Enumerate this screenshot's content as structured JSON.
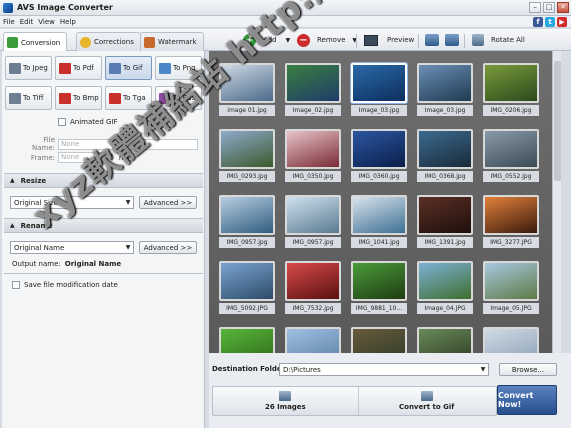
{
  "window": {
    "title": "AVS Image Converter"
  },
  "menu": [
    "File",
    "Edit",
    "View",
    "Help"
  ],
  "social": [
    "f",
    "t",
    "▶"
  ],
  "tabs": [
    {
      "label": "Conversion",
      "color": "#3a9c3a"
    },
    {
      "label": "Corrections",
      "color": "#e7b52a"
    },
    {
      "label": "Watermark",
      "color": "#c7692e"
    }
  ],
  "toolbar": {
    "add": "Add",
    "remove": "Remove",
    "preview": "Preview",
    "rotate": "Rotate All"
  },
  "formats": [
    {
      "label": "To Jpeg",
      "color": "#6f7f93"
    },
    {
      "label": "To Pdf",
      "color": "#c9302c"
    },
    {
      "label": "To Gif",
      "color": "#5a7cb4",
      "active": true
    },
    {
      "label": "To Png",
      "color": "#4c88c8"
    },
    {
      "label": "To Tiff",
      "color": "#6f7f93"
    },
    {
      "label": "To Bmp",
      "color": "#c9302c"
    },
    {
      "label": "To Tga",
      "color": "#c9302c"
    },
    {
      "label": "To Ras",
      "color": "#8a4c9c"
    }
  ],
  "options": {
    "animated_gif": "Animated GIF",
    "file_name_label": "File Name:",
    "file_name_value": "None",
    "frame_label": "Frame:",
    "frame_value": "None",
    "frame_unit": "ms"
  },
  "resize": {
    "header": "Resize",
    "select": "Original Size",
    "advanced": "Advanced >>"
  },
  "rename": {
    "header": "Rename",
    "select": "Original Name",
    "advanced": "Advanced >>",
    "output_label": "Output name:",
    "output_value": "Original Name"
  },
  "save_mod_date": "Save file modification date",
  "images": [
    {
      "name": "image 01.jpg",
      "c1": "#cfd9e4",
      "c2": "#4b6a8a"
    },
    {
      "name": "Image_02.jpg",
      "c1": "#3a7f3f",
      "c2": "#1e3c6a"
    },
    {
      "name": "Image_03.jpg",
      "c1": "#2a6aa8",
      "c2": "#0d2e5e"
    },
    {
      "name": "Image_03.jpg",
      "c1": "#6b8fb5",
      "c2": "#1f3a52"
    },
    {
      "name": "IMG_0206.jpg",
      "c1": "#7a9a3a",
      "c2": "#2b4a1e"
    },
    {
      "name": "IMG_0293.jpg",
      "c1": "#8fa9cc",
      "c2": "#3b5a2c"
    },
    {
      "name": "IMG_0350.jpg",
      "c1": "#e7c5c8",
      "c2": "#7a2b36"
    },
    {
      "name": "IMG_0360.jpg",
      "c1": "#2b56a1",
      "c2": "#0b1f4a"
    },
    {
      "name": "IMG_0368.jpg",
      "c1": "#3b6a8f",
      "c2": "#1a2b3a"
    },
    {
      "name": "IMG_0552.jpg",
      "c1": "#8a9aa8",
      "c2": "#3a4a55"
    },
    {
      "name": "IMG_0957.jpg",
      "c1": "#b8cde0",
      "c2": "#2f5d80"
    },
    {
      "name": "IMG_0957.jpg",
      "c1": "#cfe1ee",
      "c2": "#5a7a90"
    },
    {
      "name": "IMG_1041.jpg",
      "c1": "#d9e3ea",
      "c2": "#3d6f95"
    },
    {
      "name": "IMG_1391.jpg",
      "c1": "#5a2f25",
      "c2": "#1e0f0c"
    },
    {
      "name": "IMG_3277.JPG",
      "c1": "#e2813a",
      "c2": "#3a1a0d"
    },
    {
      "name": "IMG_5092.JPG",
      "c1": "#7aa3cf",
      "c2": "#2c4c6a"
    },
    {
      "name": "IMG_7532.jpg",
      "c1": "#d84a4a",
      "c2": "#5a1010"
    },
    {
      "name": "IMG_9881_10...",
      "c1": "#4a9c3a",
      "c2": "#1f3c12"
    },
    {
      "name": "Image_04.JPG",
      "c1": "#7bb1d6",
      "c2": "#3f6e2e"
    },
    {
      "name": "Image_05.JPG",
      "c1": "#a8c8e0",
      "c2": "#5d7a45"
    },
    {
      "name": "",
      "c1": "#58b53a",
      "c2": "#2e6a18"
    },
    {
      "name": "",
      "c1": "#9fc0e2",
      "c2": "#5a7ea5"
    },
    {
      "name": "",
      "c1": "#6a5a3a",
      "c2": "#2a3a2a"
    },
    {
      "name": "",
      "c1": "#6a8a5a",
      "c2": "#2a3a22"
    },
    {
      "name": "",
      "c1": "#d0dae4",
      "c2": "#8aa0b5"
    }
  ],
  "destination": {
    "label": "Destination Folder:",
    "value": "D:\\Pictures",
    "browse": "Browse..."
  },
  "summary": {
    "count": "26 Images",
    "action": "Convert to Gif"
  },
  "convert_button": "Convert Now!",
  "watermark_text": "xyz軟體補給站 http://31.to"
}
